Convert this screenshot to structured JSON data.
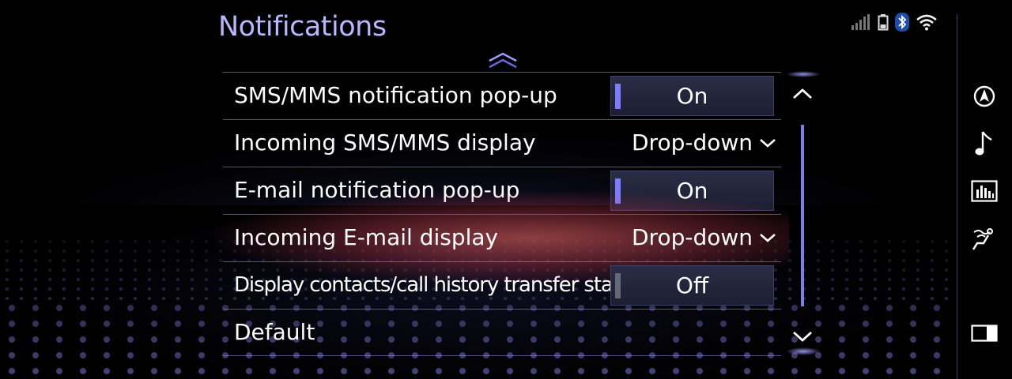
{
  "header": {
    "title": "Notifications"
  },
  "status_icons": [
    "signal-strength-icon",
    "phone-battery-icon",
    "bluetooth-icon",
    "wifi-icon"
  ],
  "settings": [
    {
      "label": "SMS/MMS notification pop-up",
      "control": "toggle",
      "value": "On"
    },
    {
      "label": "Incoming SMS/MMS display",
      "control": "dropdown",
      "value": "Drop-down"
    },
    {
      "label": "E-mail notification pop-up",
      "control": "toggle",
      "value": "On"
    },
    {
      "label": "Incoming E-mail display",
      "control": "dropdown",
      "value": "Drop-down"
    },
    {
      "label": "Display contacts/call history transfer status",
      "control": "toggle",
      "value": "Off"
    },
    {
      "label": "Default",
      "control": "none"
    }
  ],
  "side_nav": [
    "navigation-icon",
    "music-note-icon",
    "equalizer-icon",
    "climate-seat-icon",
    "split-screen-icon"
  ],
  "colors": {
    "title": "#b9b6ff",
    "accent": "#7a7dff",
    "toggle_off_indicator": "#666874",
    "scrollbar": "#7b7fe8"
  }
}
